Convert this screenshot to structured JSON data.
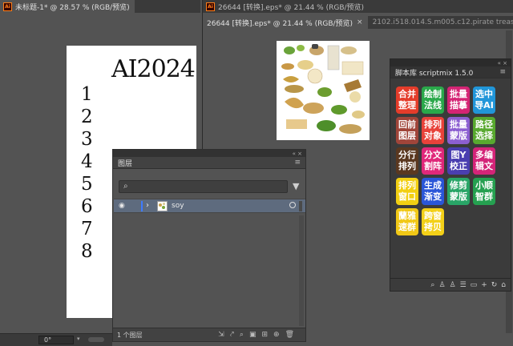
{
  "doc1": {
    "tab_title": "未标题-1* @ 28.57 % (RGB/预览)",
    "art_title": "AI2024",
    "art_numbers": [
      "1",
      "2",
      "3",
      "4",
      "5",
      "6",
      "7",
      "8"
    ]
  },
  "doc2": {
    "tab_title": "26644 [转换].eps* @ 21.44 % (RGB/预览)",
    "tab_label": "26644 [转换].eps* @ 21.44 % (RGB/预览)",
    "tab2_label": "2102.i518.014.S.m005.c12.pirate treasur",
    "close_glyph": "×"
  },
  "layers": {
    "title": "图层",
    "search_placeholder": "",
    "layer_name": "soy",
    "count": "1 个图层",
    "menu_glyph": "≡",
    "collapse_glyph": "«  ×"
  },
  "scriptmix": {
    "title": "脚本库 scriptmix 1.5.0",
    "collapse_glyph": "«  ×",
    "menu_glyph": "≡",
    "buttons": [
      {
        "label": "合并\n整理",
        "color": "#e43c2a"
      },
      {
        "label": "绘制\n法线",
        "color": "#2aa84a"
      },
      {
        "label": "批量\n描摹",
        "color": "#d42474"
      },
      {
        "label": "选中\n导AI",
        "color": "#2196d9"
      },
      {
        "label": "回前\n图层",
        "color": "#a0453a"
      },
      {
        "label": "排列\n对象",
        "color": "#e8423a"
      },
      {
        "label": "批量\n蒙版",
        "color": "#8c5fd1"
      },
      {
        "label": "路径\n选择",
        "color": "#58a92f"
      },
      {
        "label": "分行\n排列",
        "color": "#5a3820"
      },
      {
        "label": "分文\n割阵",
        "color": "#e0287a"
      },
      {
        "label": "图Y\n校正",
        "color": "#4a3fb0"
      },
      {
        "label": "多编\n辑文",
        "color": "#d42478"
      },
      {
        "label": "排列\n窗口",
        "color": "#f2cf12"
      },
      {
        "label": "生成\n渐变",
        "color": "#2a56d8"
      },
      {
        "label": "修剪\n蒙版",
        "color": "#29a567"
      },
      {
        "label": "小顺\n智群",
        "color": "#25a050"
      },
      {
        "label": "蘭雅\n速群",
        "color": "#f1c816"
      },
      {
        "label": "跨窗\n拷贝",
        "color": "#f3d018"
      }
    ]
  },
  "statusbar": {
    "zoom": "0°",
    "caret": "▾"
  },
  "icons": {
    "ai_app_icon": "Ai",
    "eye_icon": "◉",
    "search_icon": "⌕",
    "filter_icon": "▼",
    "chevron_icon": "›"
  }
}
